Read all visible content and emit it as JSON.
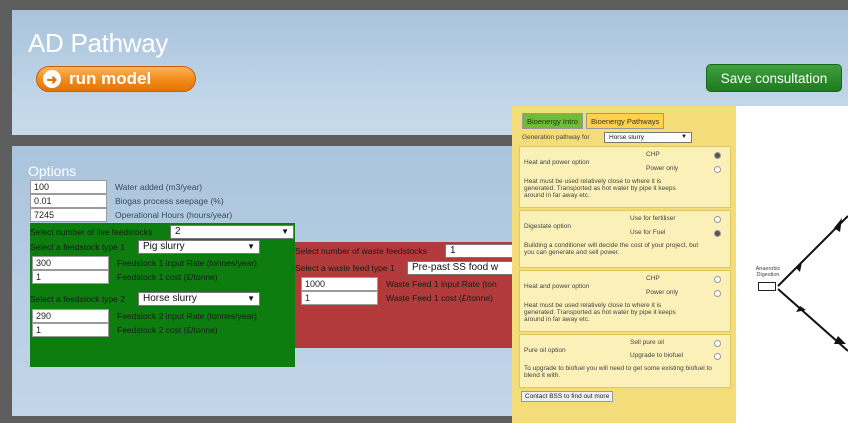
{
  "header": {
    "title": "AD Pathway",
    "run_label": "run model",
    "save_label": "Save consultation"
  },
  "options": {
    "title": "Options",
    "fields": [
      {
        "value": "100",
        "label": "Water added (m3/year)"
      },
      {
        "value": "0.01",
        "label": "Biogas process seepage (%)"
      },
      {
        "value": "7245",
        "label": "Operational Hours (hours/year)"
      }
    ],
    "livestock": {
      "count_label": "Select number of live feedstocks",
      "count_value": "2",
      "type1_label": "Select a feedstock type 1",
      "type1_value": "Pig slurry",
      "rate1_value": "300",
      "rate1_label": "Feedstock 1 input Rate (tonnes/year)",
      "cost1_value": "1",
      "cost1_label": "Feedstock 1 cost (£/tonne)",
      "type2_label": "Select a feedstock type 2",
      "type2_value": "Horse slurry",
      "rate2_value": "290",
      "rate2_label": "Feedstock 2 input Rate (tonnes/year)",
      "cost2_value": "1",
      "cost2_label": "Feedstock 2 cost (£/tonne)"
    },
    "waste": {
      "count_label": "Select number of waste feedstocks",
      "count_value": "1",
      "type_label": "Select a waste feed type 1",
      "type_value": "Pre-past SS food w",
      "rate_value": "1000",
      "rate_label": "Waste Feed 1 input Rate (ton",
      "cost_value": "1",
      "cost_label": "Waste Feed 1 cost (£/tonne)"
    }
  },
  "modal": {
    "tabs": [
      "Bioenergy Intro",
      "Bioenergy Pathways"
    ],
    "generation_label": "Generation pathway for",
    "generation_value": "Horse slurry",
    "heat_power_title": "Heat and power option",
    "chp_label": "CHP",
    "power_only_label": "Power only",
    "heat_note": "Heat must be used relatively close to where it is generated. Transported as hot water by pipe it keeps around in far away etc.",
    "digestate_title": "Digestate option",
    "fertiliser_label": "Use for fertiliser",
    "fuel_label": "Use for Fuel",
    "digestate_note": "Building a conditioner will decide the cost of your project, but you can generate and sell power.",
    "heat_power_title2": "Heat and power option",
    "chp_label2": "CHP",
    "power_only_label2": "Power only",
    "heat_note2": "Heat must be used relatively close to where it is generated. Transported as hot water by pipe it keeps around in far away etc.",
    "pure_oil_title": "Pure oil option",
    "sell_oil_label": "Sell pure oil",
    "upgrade_label": "Upgrade to biofuel",
    "pure_oil_note": "To upgrade to biofuel you will need to get some existing biofuel to blend it with.",
    "contact_label": "Contact BSS to find out more",
    "diagram_label": "Anaerobic Digestion"
  }
}
